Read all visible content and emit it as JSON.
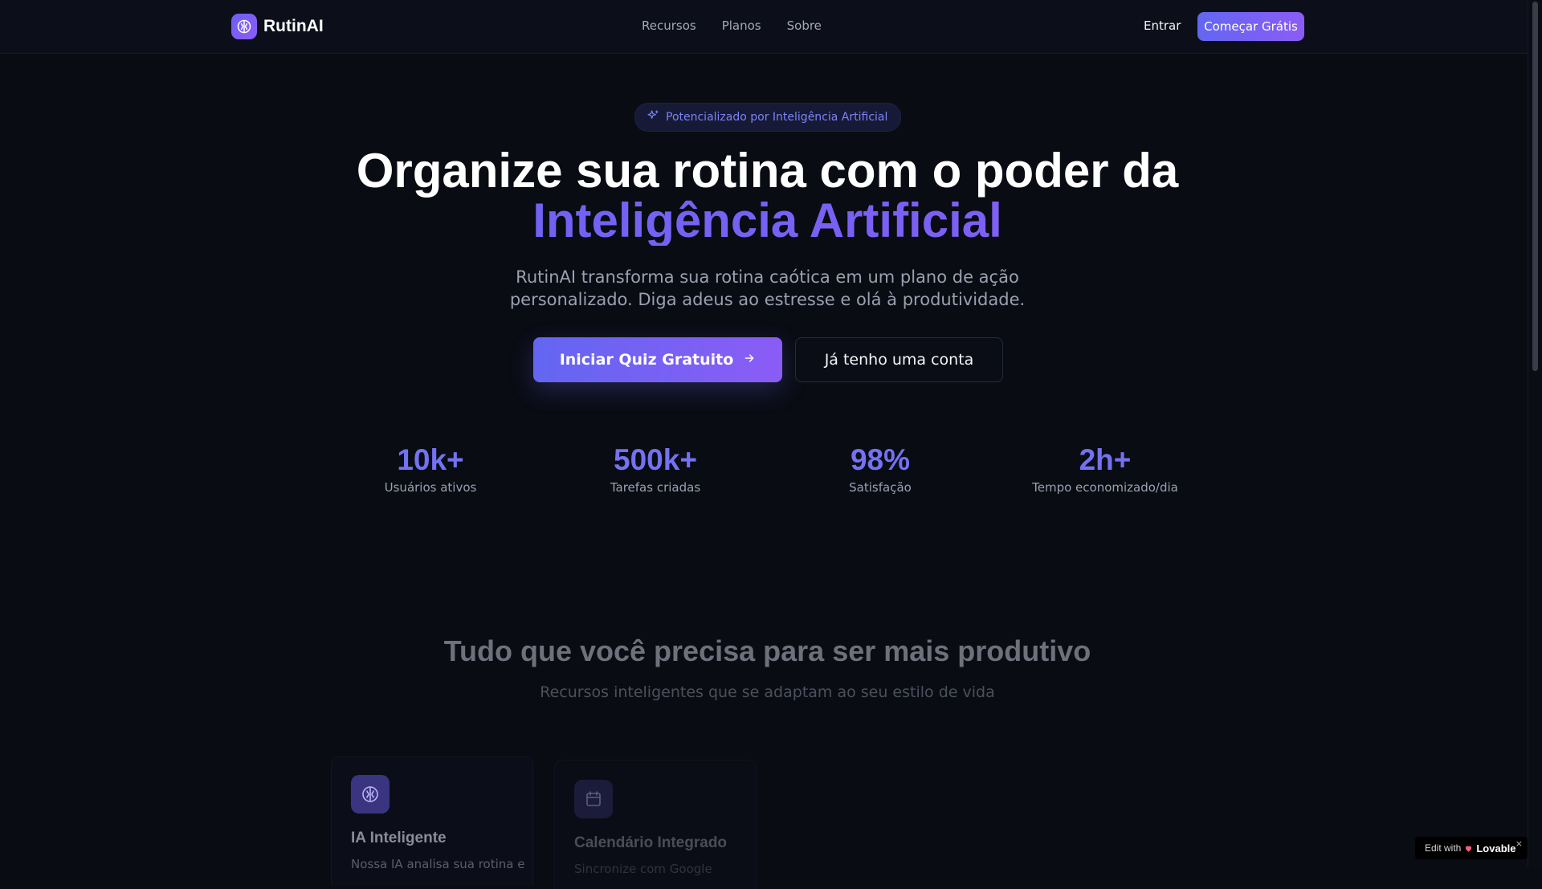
{
  "header": {
    "brand": "RutinAI",
    "nav": [
      "Recursos",
      "Planos",
      "Sobre"
    ],
    "login": "Entrar",
    "cta": "Começar Grátis"
  },
  "hero": {
    "badge": "Potencializado por Inteligência Artificial",
    "title_line1": "Organize sua rotina com o poder da",
    "title_line2": "Inteligência Artificial",
    "subtitle": "RutinAI transforma sua rotina caótica em um plano de ação personalizado. Diga adeus ao estresse e olá à produtividade.",
    "primary_button": "Iniciar Quiz Gratuito",
    "secondary_button": "Já tenho uma conta"
  },
  "stats": [
    {
      "value": "10k+",
      "label": "Usuários ativos"
    },
    {
      "value": "500k+",
      "label": "Tarefas criadas"
    },
    {
      "value": "98%",
      "label": "Satisfação"
    },
    {
      "value": "2h+",
      "label": "Tempo economizado/dia"
    }
  ],
  "features": {
    "title": "Tudo que você precisa para ser mais produtivo",
    "subtitle": "Recursos inteligentes que se adaptam ao seu estilo de vida",
    "cards": [
      {
        "icon": "brain-icon",
        "title": "IA Inteligente",
        "desc": "Nossa IA analisa sua rotina e"
      },
      {
        "icon": "calendar-icon",
        "title": "Calendário Integrado",
        "desc": "Sincronize com Google"
      }
    ]
  },
  "lovable": {
    "edit": "Edit with",
    "name": "Lovable",
    "close": "×"
  },
  "colors": {
    "accent": "#6366f1",
    "accent2": "#8b5cf6",
    "background": "#0a0c14"
  }
}
